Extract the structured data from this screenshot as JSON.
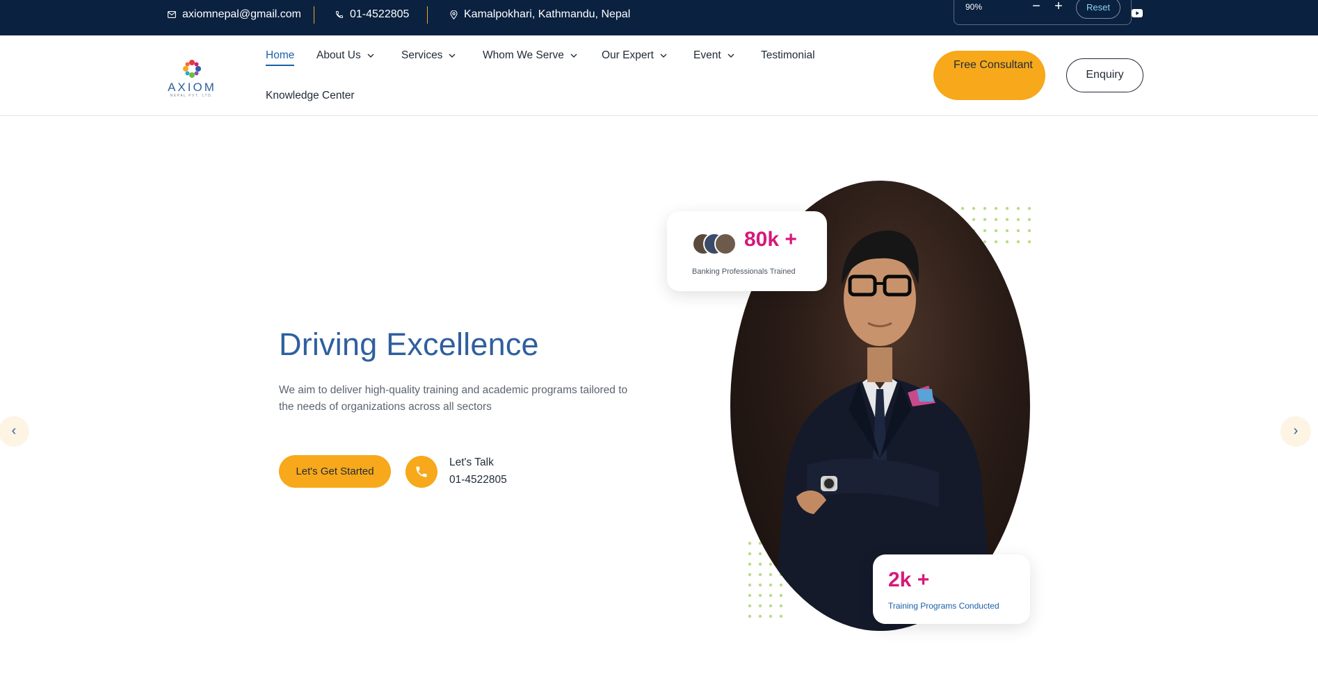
{
  "topbar": {
    "email": "axiomnepal@gmail.com",
    "phone": "01-4522805",
    "address": "Kamalpokhari, Kathmandu, Nepal",
    "zoom": {
      "value": "90%",
      "minus": "−",
      "plus": "+",
      "reset": "Reset"
    }
  },
  "header": {
    "logo_text": "AXIOM",
    "logo_subtext": "NEPAL PVT. LTD.",
    "nav": {
      "home": "Home",
      "about": "About Us",
      "services": "Services",
      "whom": "Whom We Serve",
      "expert": "Our Expert",
      "event": "Event",
      "testimonial": "Testimonial",
      "knowledge": "Knowledge Center"
    },
    "free_consultant": "Free Consultant",
    "enquiry": "Enquiry"
  },
  "hero": {
    "title": "Driving Excellence",
    "description": "We aim to deliver high-quality training and academic programs tailored to the needs of organizations across all sectors",
    "cta": "Let's Get Started",
    "talk_label": "Let's Talk",
    "talk_phone": "01-4522805",
    "prev_arrow": "‹",
    "next_arrow": "›"
  },
  "stats": [
    {
      "value": "80k +",
      "label": "Banking Professionals Trained"
    },
    {
      "value": "2k +",
      "label": "Training Programs Conducted"
    }
  ],
  "colors": {
    "topbar_bg": "#0a2140",
    "accent": "#f7a81b",
    "primary_blue": "#2f5f9e",
    "stat_pink": "#d6197a"
  }
}
